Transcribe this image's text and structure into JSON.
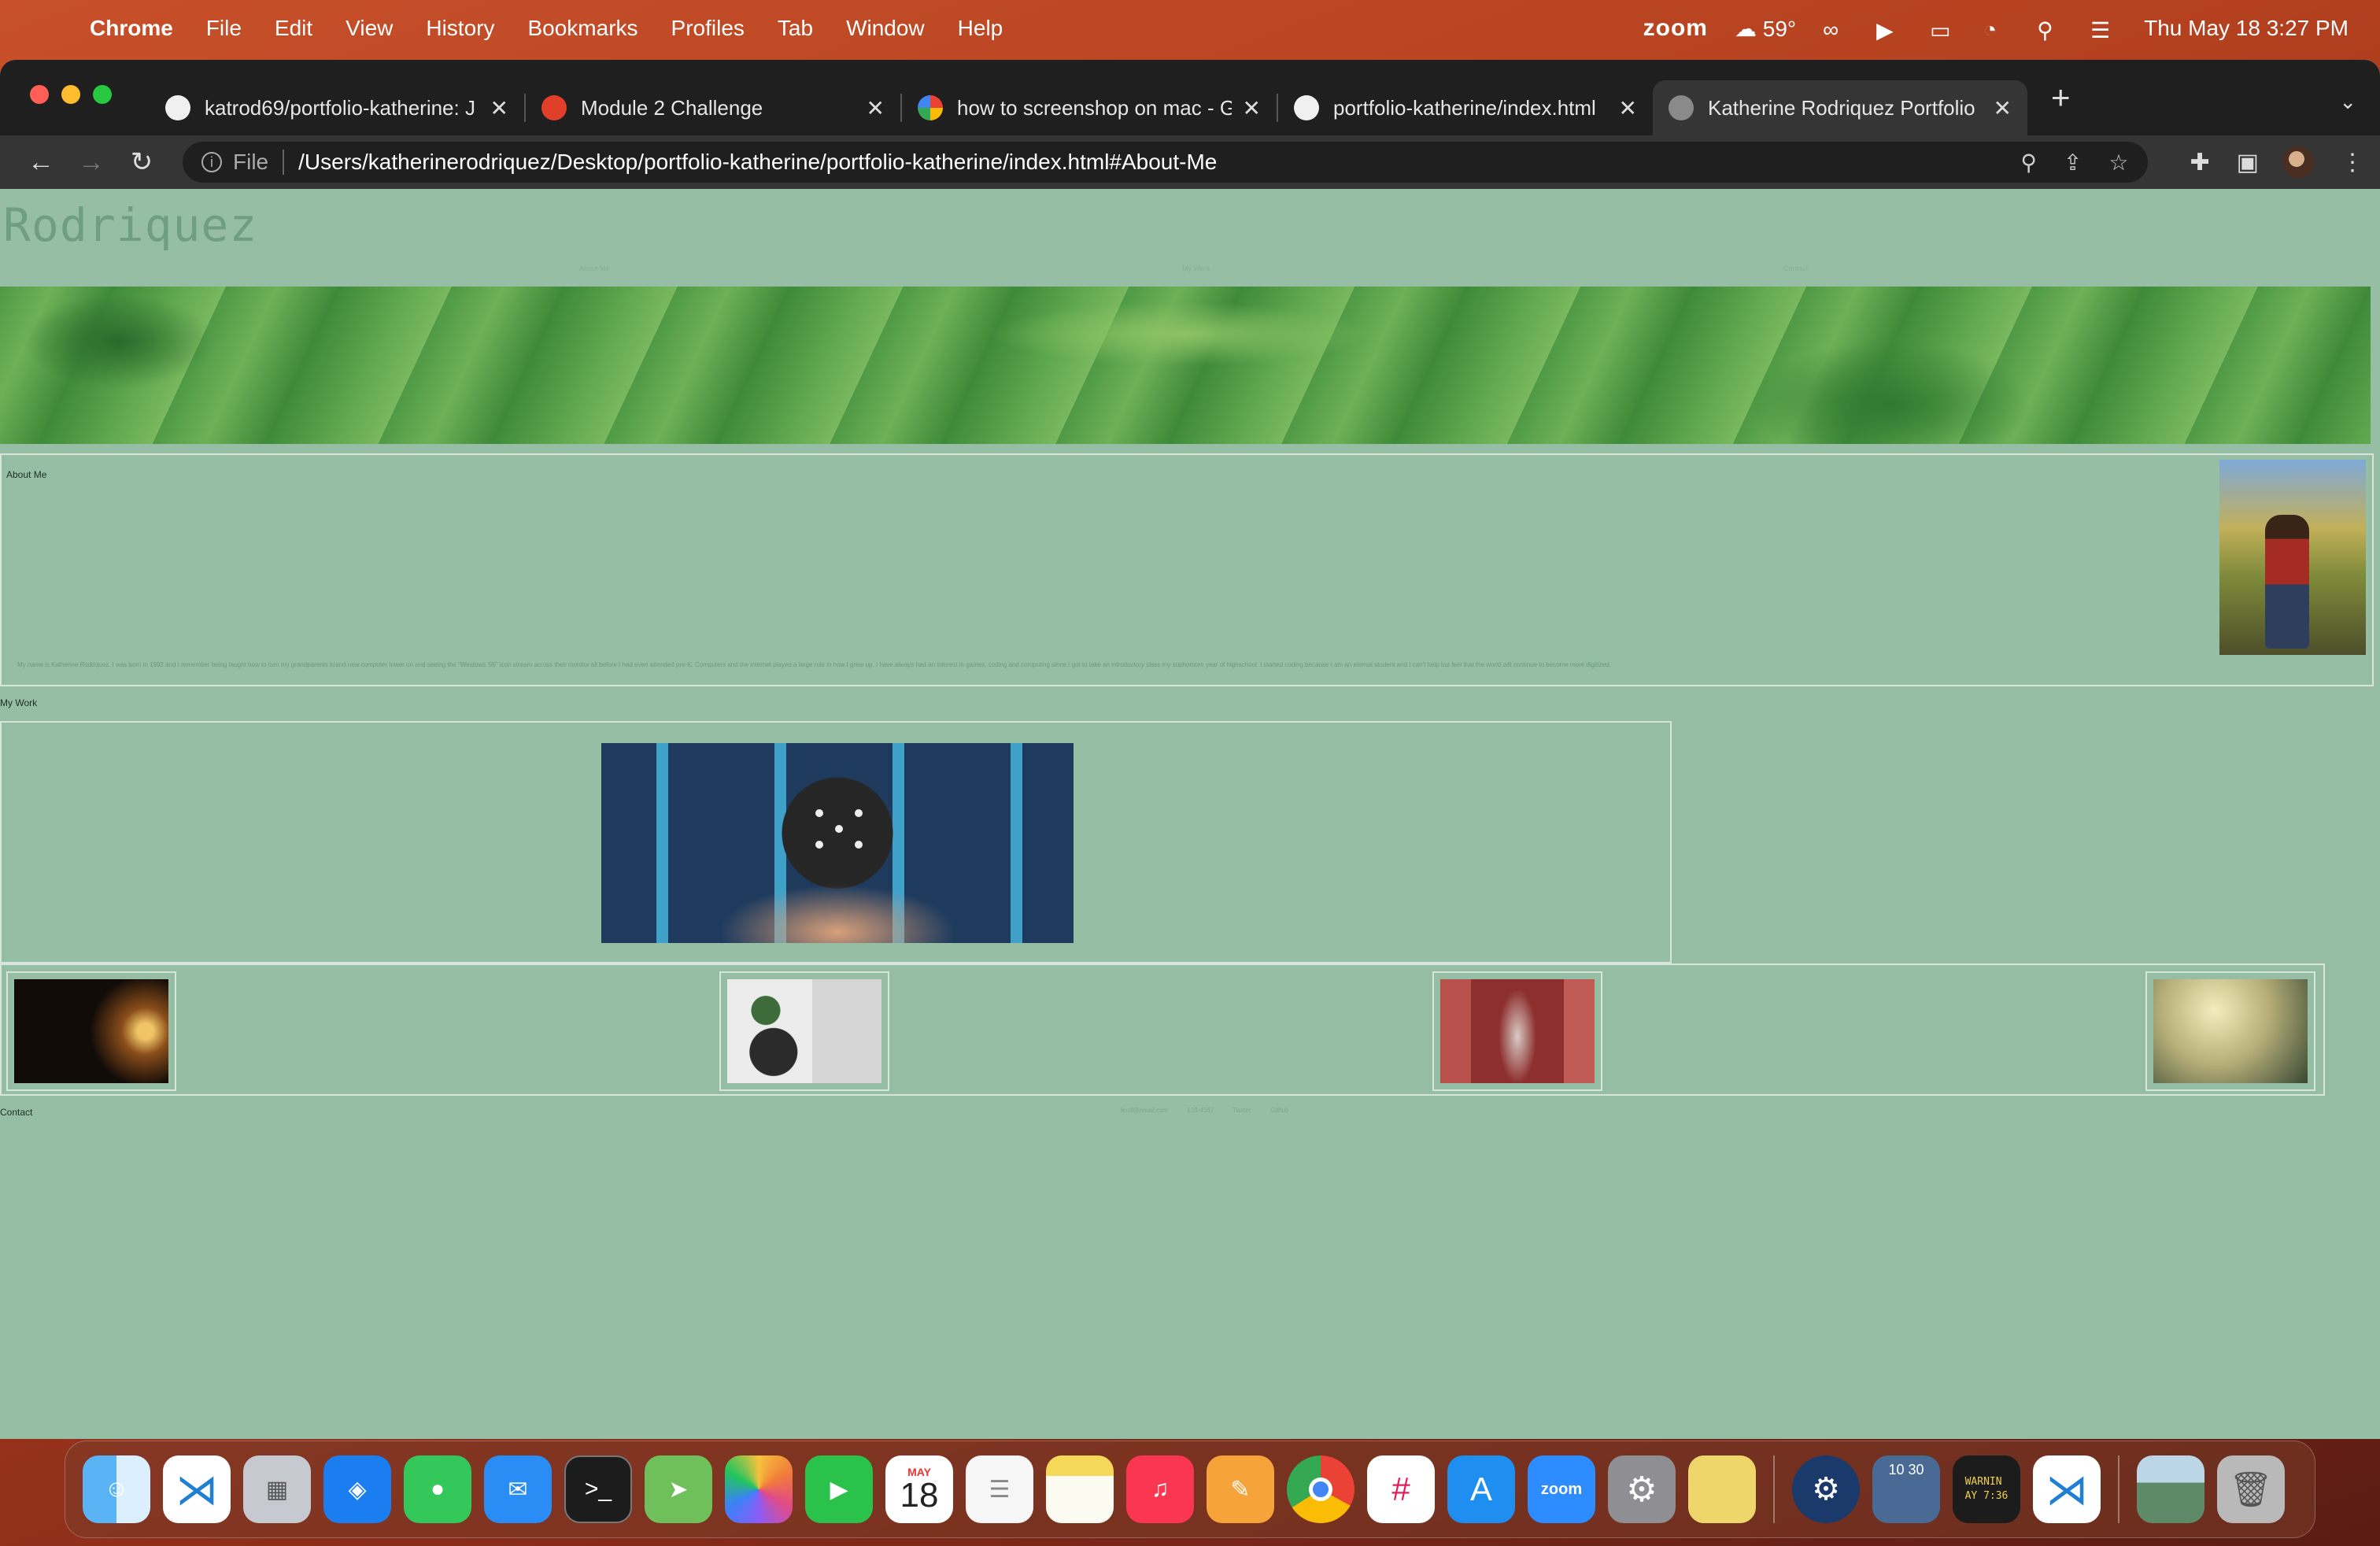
{
  "menubar": {
    "app_name": "Chrome",
    "menus": [
      "File",
      "Edit",
      "View",
      "History",
      "Bookmarks",
      "Profiles",
      "Tab",
      "Window",
      "Help"
    ],
    "zoom_label": "zoom",
    "weather": "59°",
    "datetime": "Thu May 18  3:27 PM"
  },
  "browser": {
    "tabs": [
      {
        "title": "katrod69/portfolio-katherine: J",
        "icon": "github-icon"
      },
      {
        "title": "Module 2 Challenge",
        "icon": "canvas-icon"
      },
      {
        "title": "how to screenshop on mac - G",
        "icon": "google-icon"
      },
      {
        "title": "portfolio-katherine/index.html",
        "icon": "github-icon"
      },
      {
        "title": "Katherine Rodriquez Portfolio",
        "icon": "globe-icon",
        "active": true
      }
    ],
    "address": {
      "scheme": "File",
      "url": "/Users/katherinerodriquez/Desktop/portfolio-katherine/portfolio-katherine/index.html#About-Me"
    }
  },
  "site": {
    "title": "Rodriquez",
    "nav": [
      "About Me",
      "My Work",
      "Contact"
    ],
    "about": {
      "heading": "About Me",
      "bio": "My name is Katherine Rodriquez. I was born in 1992 and I remember being taught how to turn my grandparents brand new computer tower on and seeing the \"Windows '95\" icon stream across their monitor all before I had even attended pre-K. Computers and the internet played a large role in how I grew up. I have always had an interest in games, coding and computing since I got to take an introductory class my sophomore year of highschool. I started coding because I am an eternal student and I can't help but feel that the world will continue to become more digitized."
    },
    "work_heading": "My Work",
    "contact_heading": "Contact",
    "contact_links": [
      "krod@email.com",
      "123-4567",
      "Twitter",
      "Github"
    ]
  },
  "dock": {
    "apps": [
      {
        "name": "finder-icon",
        "color": "#3a8ee6"
      },
      {
        "name": "vscode-icon",
        "color": "#1f7fd4"
      },
      {
        "name": "launchpad-icon",
        "color": "#c7c9d1"
      },
      {
        "name": "safari-icon",
        "color": "#1b7ef0"
      },
      {
        "name": "messages-icon",
        "color": "#34c759"
      },
      {
        "name": "mail-icon",
        "color": "#2a8df5"
      },
      {
        "name": "terminal-icon",
        "color": "#1c1c1c"
      },
      {
        "name": "maps-icon",
        "color": "#6fbf5a"
      },
      {
        "name": "photos-icon",
        "color": "#f2f2f2"
      },
      {
        "name": "facetime-icon",
        "color": "#2bc24c"
      },
      {
        "name": "calendar-icon",
        "color": "#ffffff"
      },
      {
        "name": "reminders-icon",
        "color": "#f6f6f6"
      },
      {
        "name": "notes-icon",
        "color": "#f7d95a"
      },
      {
        "name": "music-icon",
        "color": "#fa3650"
      },
      {
        "name": "pages-icon",
        "color": "#f6a43a"
      },
      {
        "name": "chrome-icon",
        "color": "#e9e9e9"
      },
      {
        "name": "slack-icon",
        "color": "#ffffff"
      },
      {
        "name": "appstore-icon",
        "color": "#1f8ef1"
      },
      {
        "name": "zoom-icon",
        "color": "#2d8cff"
      },
      {
        "name": "settings-icon",
        "color": "#8e8e93"
      },
      {
        "name": "stickies-icon",
        "color": "#efd66a"
      },
      {
        "name": "steam-icon",
        "color": "#1a3a6c"
      },
      {
        "name": "clock-widget-icon",
        "color": "#4a6a96"
      },
      {
        "name": "console-icon",
        "color": "#1c1c1c"
      },
      {
        "name": "vscode-alt-icon",
        "color": "#1f7fd4"
      },
      {
        "name": "downloads-stack-icon",
        "color": "#5e8a6a"
      },
      {
        "name": "trash-icon",
        "color": "#b9b9b9"
      }
    ],
    "calendar_month": "MAY",
    "calendar_day": "18",
    "zoom_text": "zoom",
    "clock_widget_text": "10 30",
    "console_text": "WARNIN\nAY 7:36"
  }
}
